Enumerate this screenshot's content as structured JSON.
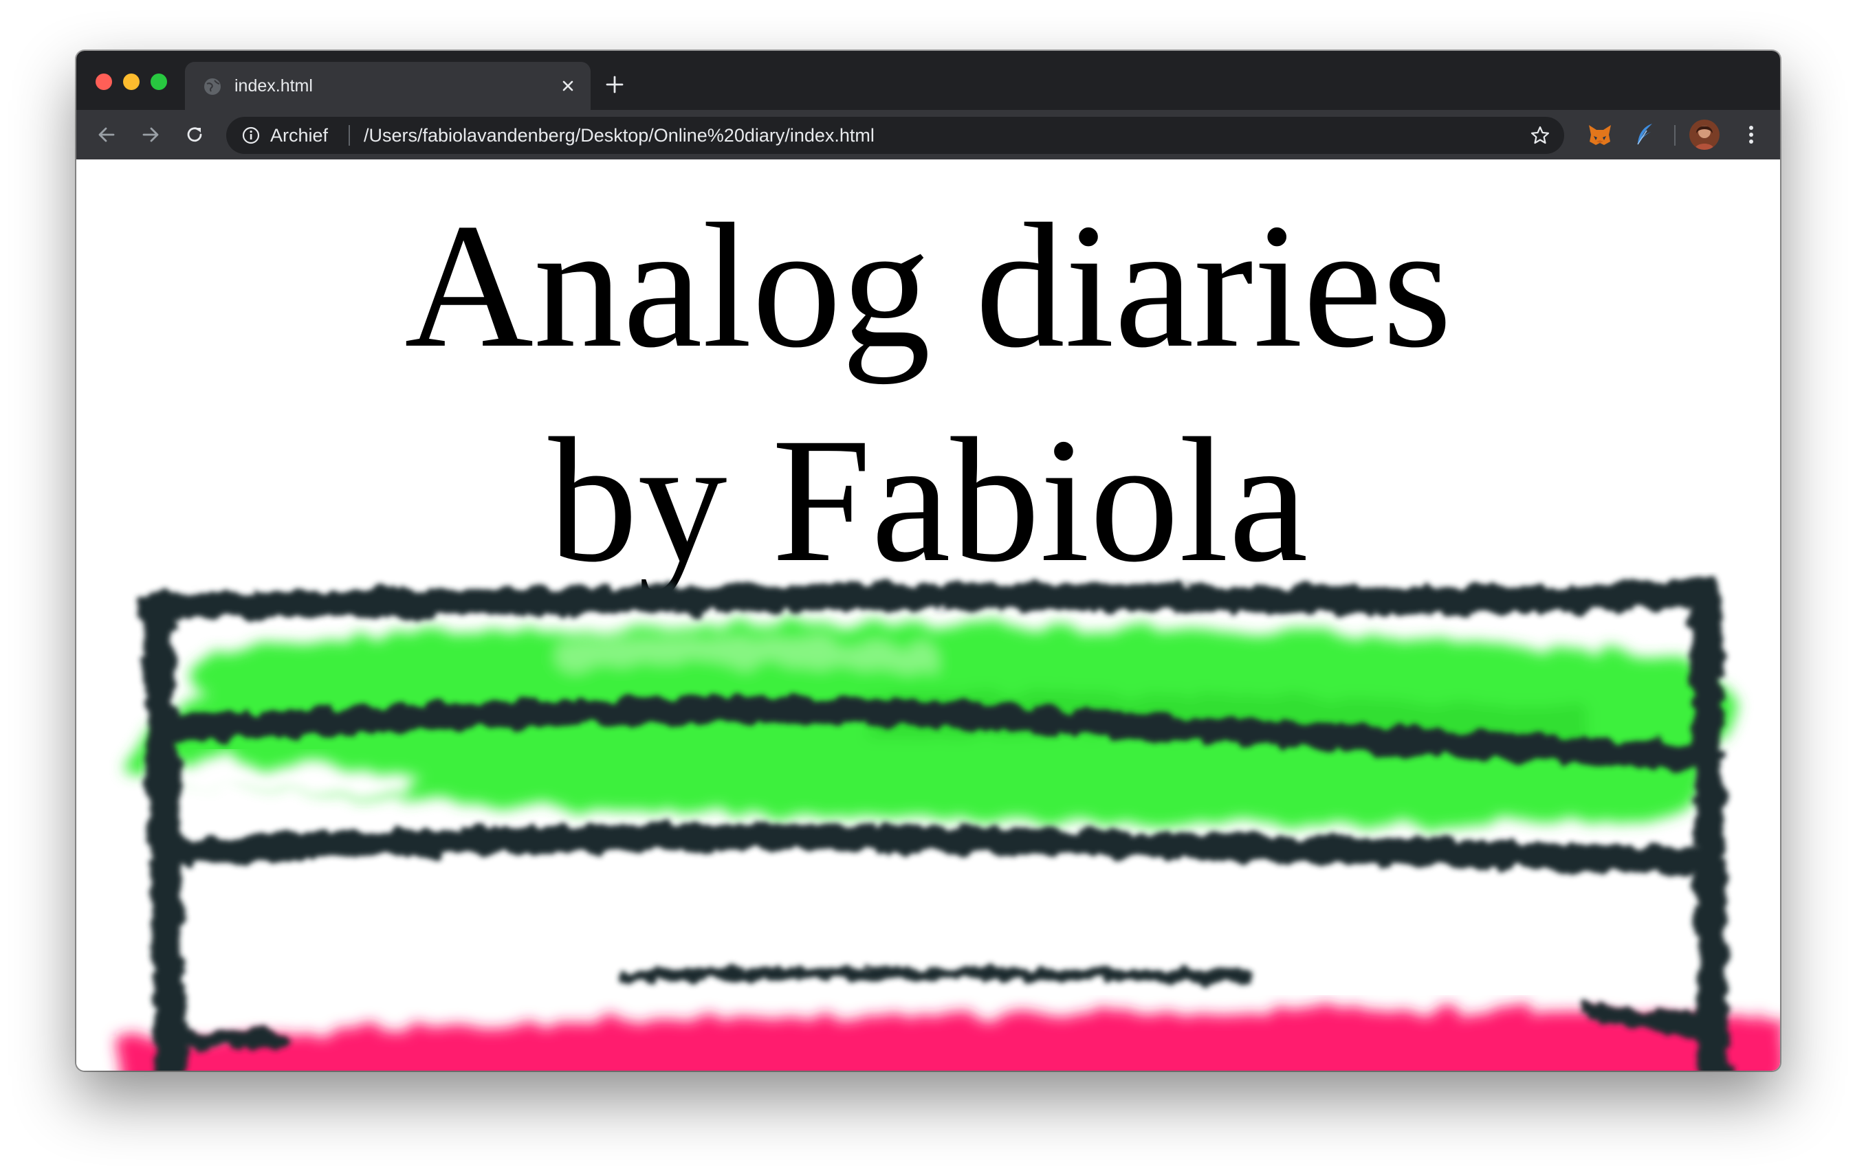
{
  "browser": {
    "tab": {
      "title": "index.html",
      "favicon": "globe-icon",
      "close_icon": "close-icon"
    },
    "new_tab_icon": "plus-icon",
    "toolbar": {
      "back_icon": "arrow-left-icon",
      "forward_icon": "arrow-right-icon",
      "reload_icon": "reload-icon",
      "info_icon": "info-icon",
      "site_chip": "Archief",
      "url": "/Users/fabiolavandenberg/Desktop/Online%20diary/index.html",
      "bookmark_icon": "star-icon",
      "extensions": [
        "fox-extension-icon",
        "feather-extension-icon"
      ],
      "profile": "avatar",
      "menu_icon": "kebab-menu-icon"
    },
    "colors": {
      "tabstrip": "#202124",
      "toolbar": "#35363a",
      "close": "#ff5f57",
      "minimize": "#febc2e",
      "zoom": "#28c840"
    }
  },
  "page": {
    "title_line_1": "Analog diaries",
    "title_line_2": "by Fabiola",
    "artwork": {
      "name": "spray-painted-bench",
      "colors": {
        "frame": "#1b2a2e",
        "green": "#3ef03e",
        "pink": "#ff1f6e"
      }
    }
  }
}
